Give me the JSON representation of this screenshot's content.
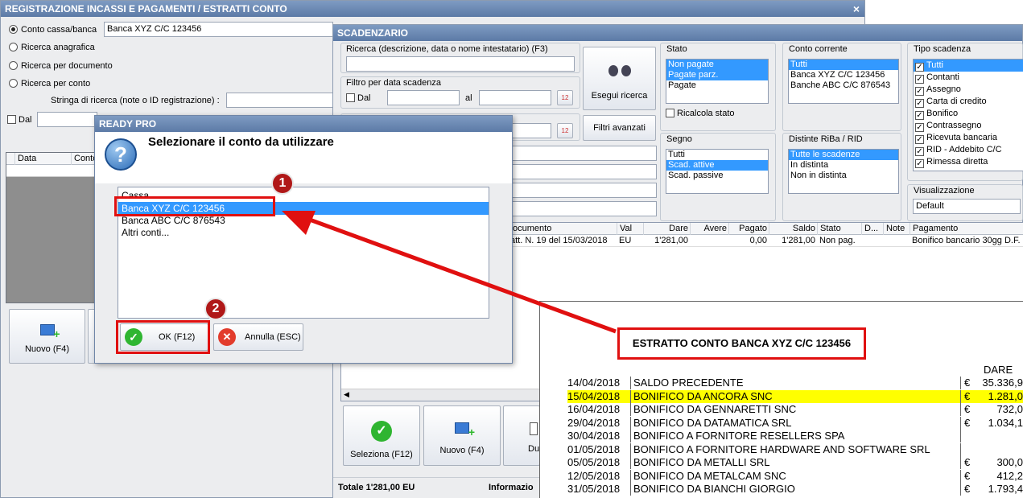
{
  "registrazione": {
    "title": "REGISTRAZIONE INCASSI E PAGAMENTI / ESTRATTI CONTO",
    "close": "×",
    "radio_conto": "Conto cassa/banca",
    "conto_value": "Banca XYZ C/C 123456",
    "radio_anagrafica": "Ricerca anagrafica",
    "radio_documento": "Ricerca per documento",
    "radio_conto2": "Ricerca per conto",
    "stringa_label": "Stringa di ricerca (note o ID registrazione) :",
    "dal_label": "Dal",
    "col_data": "Data",
    "col_conto": "Conto",
    "nuovo": "Nuovo (F4)"
  },
  "scadenzario": {
    "title": "SCADENZARIO",
    "ricerca_label": "Ricerca (descrizione, data o nome intestatario) (F3)",
    "filtro_data_label": "Filtro per data scadenza",
    "dal": "Dal",
    "al": "al",
    "esegui_ricerca": "Esegui ricerca",
    "filtri_avanzati": "Filtri avanzati",
    "stato": {
      "label": "Stato",
      "items": [
        "Non pagate",
        "Pagate parz.",
        "Pagate"
      ]
    },
    "ricalcola": "Ricalcola stato",
    "segno": {
      "label": "Segno",
      "items": [
        "Tutti",
        "Scad. attive",
        "Scad. passive"
      ]
    },
    "conto_corrente": {
      "label": "Conto corrente",
      "items": [
        "Tutti",
        "Banca XYZ C/C 123456",
        "Banche ABC C/C 876543"
      ]
    },
    "distinte": {
      "label": "Distinte RiBa / RID",
      "items": [
        "Tutte le scadenze",
        "In distinta",
        "Non in distinta"
      ]
    },
    "tipo_scadenza": {
      "label": "Tipo scadenza",
      "items": [
        "Tutti",
        "Contanti",
        "Assegno",
        "Carta di credito",
        "Bonifico",
        "Contrassegno",
        "Ricevuta bancaria",
        "RID - Addebito C/C",
        "Rimessa diretta"
      ]
    },
    "visualizzazione": {
      "label": "Visualizzazione",
      "value": "Default"
    },
    "columns": [
      "ocumento",
      "Val",
      "Dare",
      "Avere",
      "Pagato",
      "Saldo",
      "Stato",
      "D...",
      "Note",
      "Pagamento"
    ],
    "row": {
      "documento": "att. N. 19 del 15/03/2018",
      "val": "EU",
      "dare": "1'281,00",
      "avere": "",
      "pagato": "0,00",
      "saldo": "1'281,00",
      "stato": "Non pag.",
      "d": "",
      "note": "",
      "pagamento": "Bonifico bancario 30gg D.F."
    },
    "seleziona": "Seleziona (F12)",
    "nuovo": "Nuovo (F4)",
    "du": "Du",
    "totale": "Totale 1'281,00 EU",
    "informazioni": "Informazio"
  },
  "dialog": {
    "title": "READY PRO",
    "message": "Selezionare il conto da utilizzare",
    "items": [
      "Cassa",
      "Banca XYZ C/C 123456",
      "Banca ABC C/C 876543",
      "Altri conti..."
    ],
    "ok": "OK (F12)",
    "annulla": "Annulla (ESC)"
  },
  "badges": [
    "1",
    "2"
  ],
  "estratto": {
    "title": "ESTRATTO CONTO BANCA XYZ C/C 123456",
    "col_dare": "DARE",
    "rows": [
      {
        "date": "14/04/2018",
        "desc": "SALDO PRECEDENTE",
        "cur": "€",
        "amount": "35.336,9"
      },
      {
        "date": "15/04/2018",
        "desc": "BONIFICO DA ANCORA SNC",
        "cur": "€",
        "amount": "1.281,0"
      },
      {
        "date": "16/04/2018",
        "desc": "BONIFICO DA GENNARETTI SNC",
        "cur": "€",
        "amount": "732,0"
      },
      {
        "date": "29/04/2018",
        "desc": "BONIFICO DA DATAMATICA SRL",
        "cur": "€",
        "amount": "1.034,1"
      },
      {
        "date": "30/04/2018",
        "desc": "BONIFICO A FORNITORE RESELLERS SPA",
        "cur": "",
        "amount": ""
      },
      {
        "date": "01/05/2018",
        "desc": "BONIFICO A FORNITORE HARDWARE AND SOFTWARE SRL",
        "cur": "",
        "amount": ""
      },
      {
        "date": "05/05/2018",
        "desc": "BONIFICO DA METALLI SRL",
        "cur": "€",
        "amount": "300,0"
      },
      {
        "date": "12/05/2018",
        "desc": "BONIFICO DA METALCAM SNC",
        "cur": "€",
        "amount": "412,2"
      },
      {
        "date": "31/05/2018",
        "desc": "BONIFICO DA BIANCHI GIORGIO",
        "cur": "€",
        "amount": "1.793,4"
      }
    ]
  },
  "colors": {
    "title_bar": "#6a88b4",
    "selection": "#3399ff",
    "highlight": "#ffff00",
    "annotation": "#e01010"
  }
}
